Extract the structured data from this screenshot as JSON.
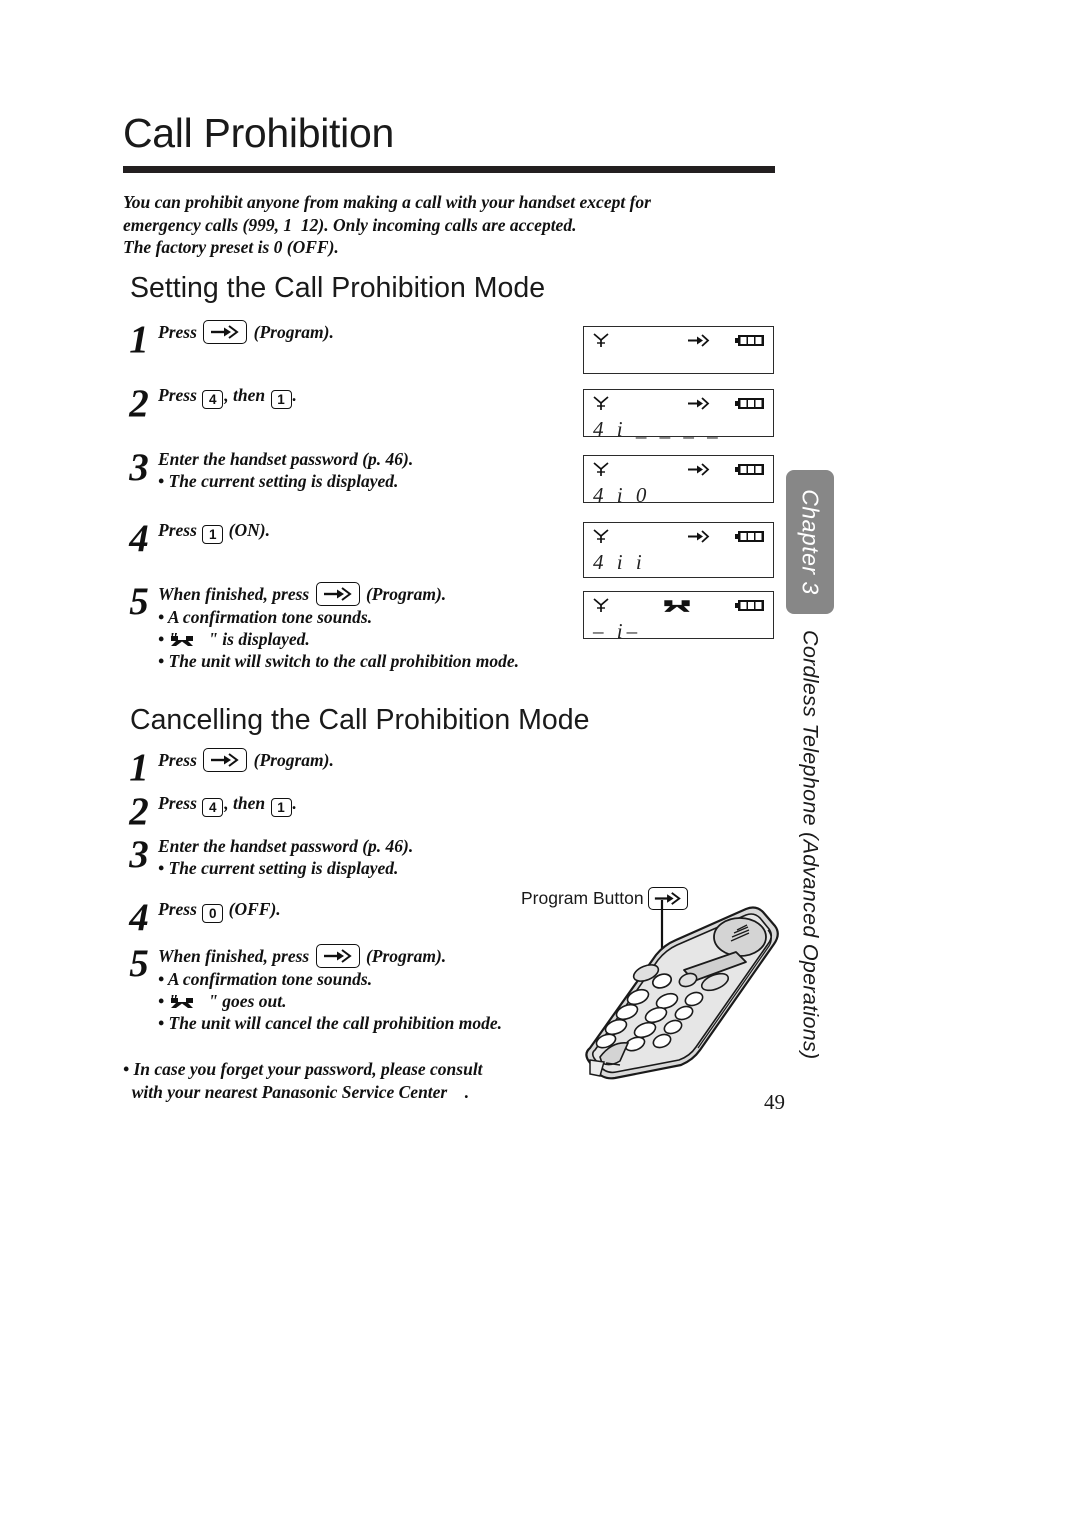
{
  "document": {
    "title": "Call Prohibition",
    "page_number": "49"
  },
  "intro": {
    "line1": "You can prohibit anyone from making a call with your handset except for",
    "line2": "emergency calls (999, 1  12). Only incoming calls are accepted.",
    "line3": "The factory preset is 0 (OFF)."
  },
  "sections": [
    {
      "heading": "Setting the Call Prohibition Mode",
      "steps": [
        {
          "number": "1",
          "text_before": "Press",
          "key": "program-icon",
          "text_after": "(Program).",
          "bullets": []
        },
        {
          "number": "2",
          "text_before": "Press",
          "key1": "4",
          "text_middle": ", then",
          "key2": "1",
          "text_after": ".",
          "bullets": []
        },
        {
          "number": "3",
          "text_main": "Enter the handset password (p. 46).",
          "bullets": [
            "• The current setting is displayed."
          ]
        },
        {
          "number": "4",
          "text_before": "Press",
          "key1": "1",
          "text_after": "(ON).",
          "bullets": []
        },
        {
          "number": "5",
          "text_before": "When finished, press",
          "key": "program-icon",
          "text_after": "(Program).",
          "bullets": [
            "• A confirmation tone sounds.",
            "• \"",
            "\" is displayed.",
            "• The unit will switch to the call prohibition mode."
          ]
        }
      ]
    },
    {
      "heading": "Cancelling the Call Prohibition Mode",
      "steps": [
        {
          "number": "1",
          "text_before": "Press",
          "key": "program-icon",
          "text_after": "(Program).",
          "bullets": []
        },
        {
          "number": "2",
          "text_before": "Press",
          "key1": "4",
          "text_middle": ", then",
          "key2": "1",
          "text_after": ".",
          "bullets": []
        },
        {
          "number": "3",
          "text_main": "Enter the handset password (p. 46).",
          "bullets": [
            "• The current setting is displayed."
          ]
        },
        {
          "number": "4",
          "text_before": "Press",
          "key1": "0",
          "text_after": "(OFF).",
          "bullets": []
        },
        {
          "number": "5",
          "text_before": "When finished, press",
          "key": "program-icon",
          "text_after": "(Program).",
          "bullets": [
            "• A confirmation tone sounds.",
            "• \"",
            "\" goes out.",
            "• The unit will cancel the call prohibition mode."
          ]
        }
      ]
    }
  ],
  "lcd_displays": [
    {
      "id": "lcd-1",
      "antenna": true,
      "program_arrow": true,
      "prohibition": false,
      "battery": "full",
      "text": ""
    },
    {
      "id": "lcd-2",
      "antenna": true,
      "program_arrow": true,
      "prohibition": false,
      "battery": "full",
      "text": "4 i _ _ _ _"
    },
    {
      "id": "lcd-3",
      "antenna": true,
      "program_arrow": true,
      "prohibition": false,
      "battery": "full",
      "text": "4 i 0"
    },
    {
      "id": "lcd-4",
      "antenna": true,
      "program_arrow": true,
      "prohibition": false,
      "battery": "full",
      "text": "4 i i"
    },
    {
      "id": "lcd-5",
      "antenna": true,
      "program_arrow": false,
      "prohibition": true,
      "battery": "full",
      "text": "– i–"
    }
  ],
  "callout": {
    "label": "Program Button"
  },
  "sidebar": {
    "chapter_tab": "Chapter 3",
    "vertical_label": "Cordless Telephone (Advanced Operations)",
    "tab_color": "#878787"
  },
  "footer_note": {
    "line1": "• In case you forget your password, please consult",
    "line2": "  with your nearest Panasonic Service Center    ."
  }
}
